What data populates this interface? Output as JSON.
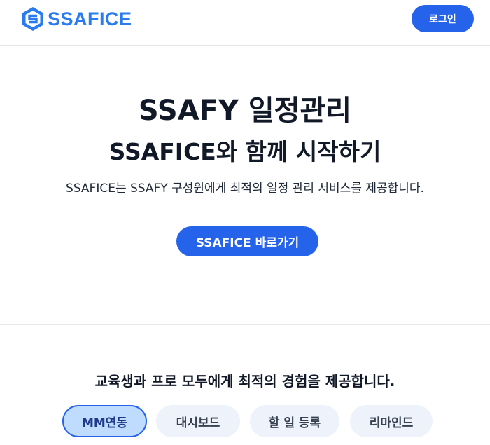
{
  "header": {
    "logo_text": "SSAFICE",
    "login_label": "로그인"
  },
  "hero": {
    "title_line1": "SSAFY 일정관리",
    "title_line2": "SSAFICE와 함께 시작하기",
    "description": "SSAFICE는 SSAFY 구성원에게 최적의 일정 관리 서비스를 제공합니다.",
    "cta_label": "SSAFICE 바로가기"
  },
  "features": {
    "title": "교육생과 프로 모두에게 최적의 경험을 제공합니다.",
    "tabs": [
      {
        "label": "MM연동",
        "active": true
      },
      {
        "label": "대시보드",
        "active": false
      },
      {
        "label": "할 일 등록",
        "active": false
      },
      {
        "label": "리마인드",
        "active": false
      }
    ]
  },
  "colors": {
    "brand": "#2b7bf0",
    "primary_button": "#2563eb",
    "active_tab_bg": "#bfdbfe",
    "tab_bg": "#eef3fb"
  },
  "icons": {
    "logo": "hexagon-s-logo-icon"
  }
}
